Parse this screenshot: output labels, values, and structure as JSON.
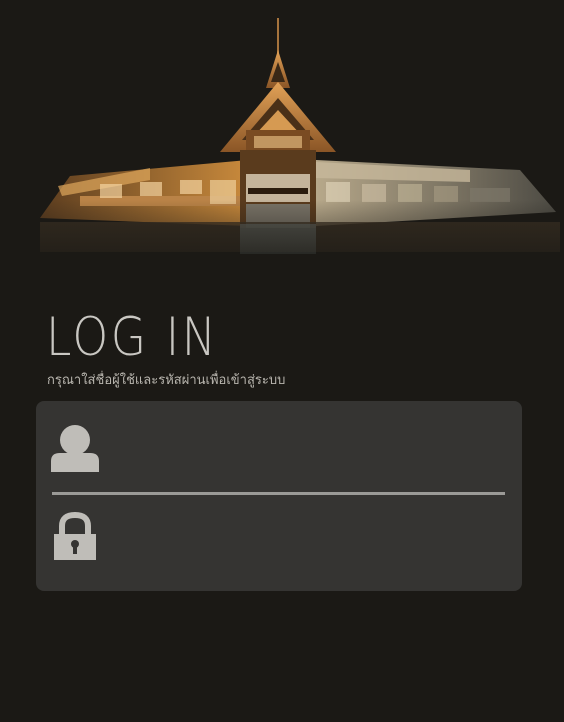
{
  "login": {
    "title": "LOG IN",
    "subtitle": "กรุณาใส่ชื่อผู้ใช้และรหัสผ่านเพื่อเข้าสู่ระบบ"
  },
  "fields": {
    "username": {
      "icon": "user-icon",
      "value": "",
      "placeholder": ""
    },
    "password": {
      "icon": "lock-icon",
      "value": "",
      "placeholder": ""
    }
  },
  "colors": {
    "background": "#1b1915",
    "card": "#353432",
    "divider": "#9b9a97",
    "icon": "#bfbdb8",
    "title": "#c9c7c2",
    "temple_gold": "#c98a3c"
  }
}
